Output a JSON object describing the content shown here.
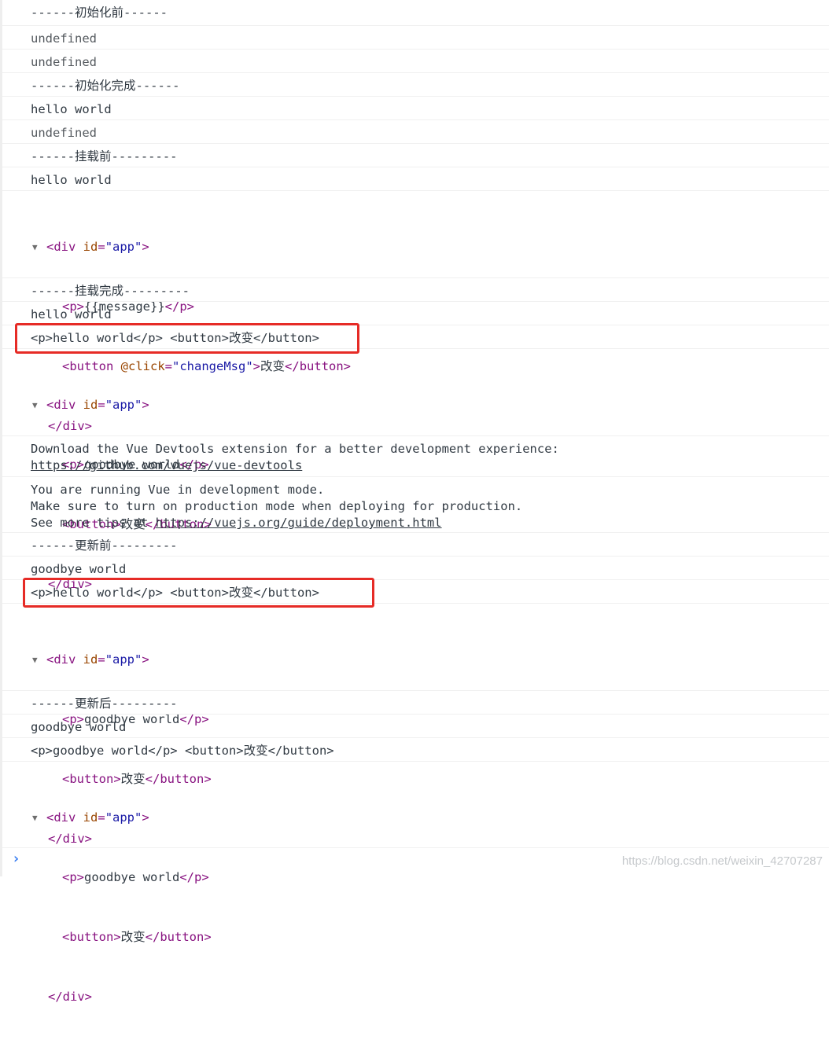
{
  "console": {
    "l1": "------初始化前------",
    "l2": "undefined",
    "l3": "undefined",
    "l4": "------初始化完成------",
    "l5": "hello world",
    "l6": "undefined",
    "l7": "------挂载前---------",
    "l8": "hello world",
    "dom1": {
      "open": "<div",
      "attr": "id",
      "eq": "=",
      "val": "\"app\"",
      "close_gt": ">",
      "p_open": "<p>",
      "p_text": "{{message}}",
      "p_close": "</p>",
      "btn_open": "<button",
      "btn_attr": "@click",
      "btn_eq": "=",
      "btn_val": "\"changeMsg\"",
      "btn_gt": ">",
      "btn_text": "改变",
      "btn_close": "</button>",
      "div_close": "</div>"
    },
    "l9": "------挂载完成---------",
    "l10": "hello world",
    "l11": "<p>hello world</p> <button>改变</button>",
    "dom2": {
      "open": "<div",
      "attr": "id",
      "eq": "=",
      "val": "\"app\"",
      "close_gt": ">",
      "p_open": "<p>",
      "p_text": "goodbye world",
      "p_close": "</p>",
      "btn_open": "<button>",
      "btn_text": "改变",
      "btn_close": "</button>",
      "div_close": "</div>"
    },
    "devtools_1": "Download the Vue Devtools extension for a better development experience:",
    "devtools_link": "https://github.com/vuejs/vue-devtools",
    "mode_1": "You are running Vue in development mode.",
    "mode_2": "Make sure to turn on production mode when deploying for production.",
    "mode_3_prefix": "See more tips at ",
    "mode_3_link": "https://vuejs.org/guide/deployment.html",
    "l12": "------更新前---------",
    "l13": "goodbye world",
    "l14": "<p>hello world</p> <button>改变</button>",
    "dom3": {
      "open": "<div",
      "attr": "id",
      "eq": "=",
      "val": "\"app\"",
      "close_gt": ">",
      "p_open": "<p>",
      "p_text": "goodbye world",
      "p_close": "</p>",
      "btn_open": "<button>",
      "btn_text": "改变",
      "btn_close": "</button>",
      "div_close": "</div>"
    },
    "l15": "------更新后---------",
    "l16": "goodbye world",
    "l17": "<p>goodbye world</p> <button>改变</button>",
    "dom4": {
      "open": "<div",
      "attr": "id",
      "eq": "=",
      "val": "\"app\"",
      "close_gt": ">",
      "p_open": "<p>",
      "p_text": "goodbye world",
      "p_close": "</p>",
      "btn_open": "<button>",
      "btn_text": "改变",
      "btn_close": "</button>",
      "div_close": "</div>"
    },
    "prompt": "›",
    "watermark": "https://blog.csdn.net/weixin_42707287"
  },
  "colors": {
    "highlight": "#e62b26",
    "tag": "#881280",
    "attr": "#994500",
    "value": "#1a1aa6",
    "prompt": "#367cf1"
  }
}
